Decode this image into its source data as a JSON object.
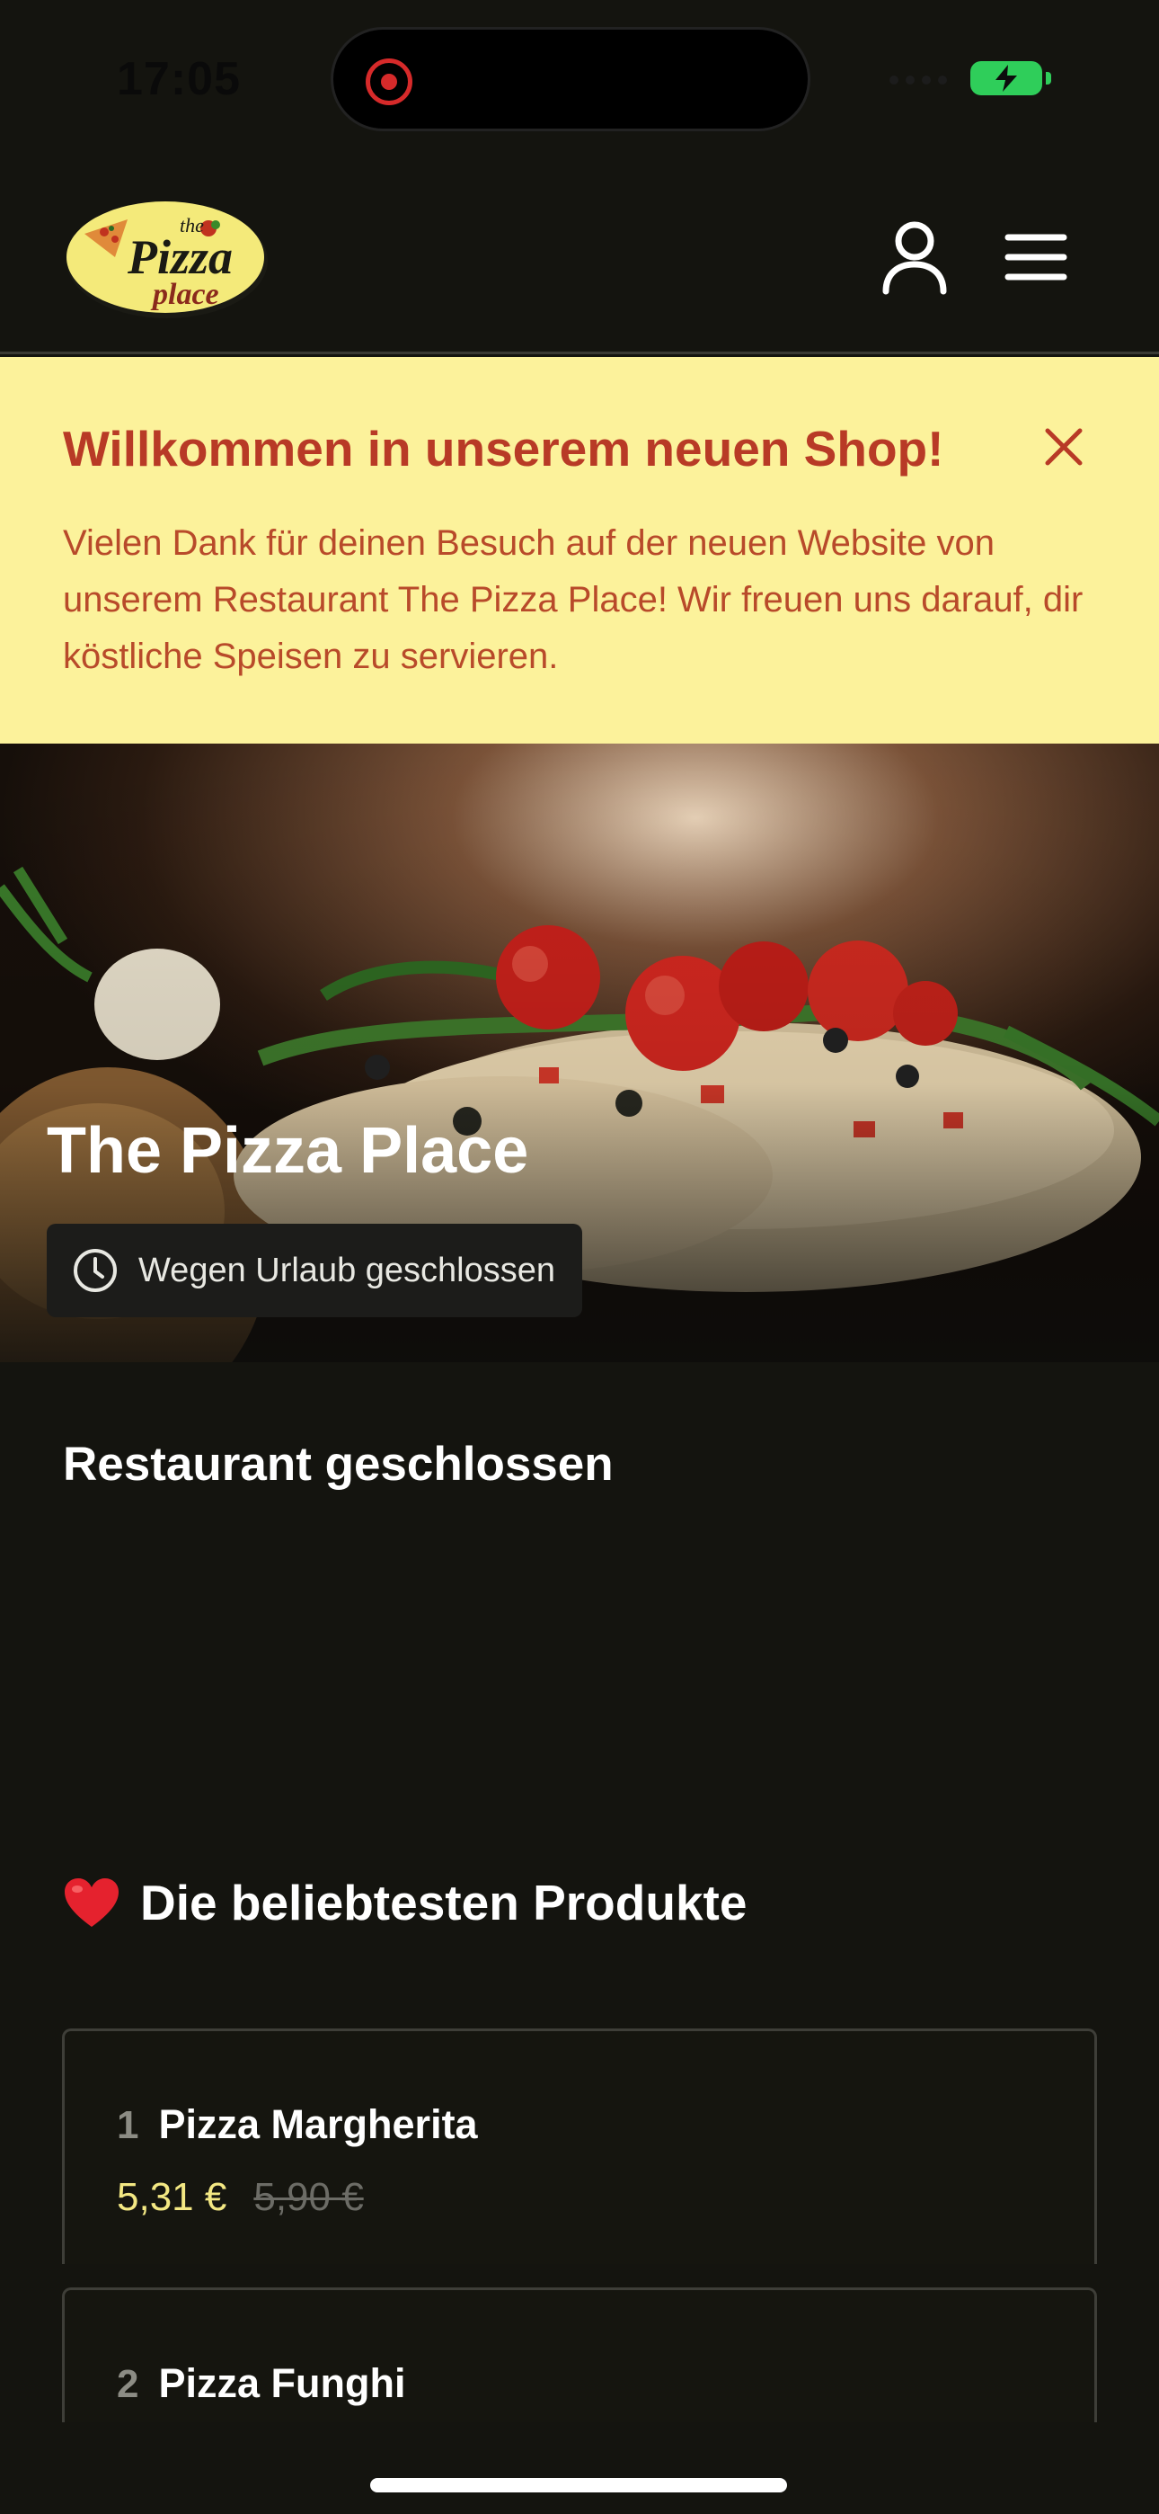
{
  "status_bar": {
    "time": "17:05"
  },
  "header": {
    "logo_text_the": "the",
    "logo_text_pizza": "Pizza",
    "logo_text_place": "place"
  },
  "notice": {
    "title": "Willkommen in unserem neuen Shop!",
    "text": "Vielen Dank für deinen Besuch auf der neuen Website von unserem Restaurant The Pizza Place! Wir freuen uns darauf, dir köstliche Speisen zu servieren."
  },
  "hero": {
    "title": "The Pizza Place",
    "hours_status": "Wegen Urlaub geschlossen"
  },
  "closed_heading": "Restaurant geschlossen",
  "popular": {
    "title": "Die beliebtesten Produkte",
    "products": [
      {
        "number": "1",
        "name": "Pizza Margherita",
        "price": "5,31 €",
        "old_price": "5,90 €"
      },
      {
        "number": "2",
        "name": "Pizza Funghi"
      }
    ]
  },
  "colors": {
    "background": "#14140f",
    "notice_bg": "#fcf29b",
    "notice_text": "#b83a26",
    "price": "#f3e883"
  }
}
